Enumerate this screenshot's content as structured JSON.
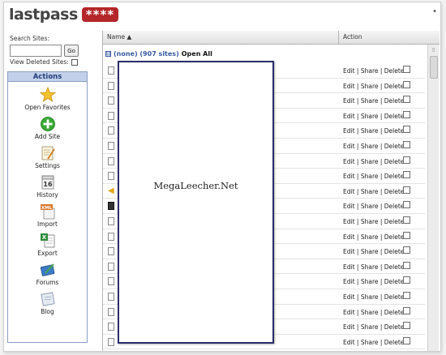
{
  "brand": {
    "logo_text": "lastpass",
    "logo_badge": "****",
    "corner_mark": "•"
  },
  "search": {
    "label": "Search Sites:",
    "value": "",
    "go_label": "Go",
    "deleted_label": "View Deleted Sites:"
  },
  "actions": {
    "title": "Actions",
    "items": [
      {
        "label": "Open Favorites",
        "icon": "star-icon"
      },
      {
        "label": "Add Site",
        "icon": "add-icon"
      },
      {
        "label": "Settings",
        "icon": "settings-icon"
      },
      {
        "label": "History",
        "icon": "calendar-icon",
        "badge": "16"
      },
      {
        "label": "Import",
        "icon": "xml-import-icon",
        "badge": "XML"
      },
      {
        "label": "Export",
        "icon": "excel-export-icon"
      },
      {
        "label": "Forums",
        "icon": "forums-icon"
      },
      {
        "label": "Blog",
        "icon": "blog-icon"
      }
    ]
  },
  "grid": {
    "col_name": "Name ▲",
    "col_action": "Action",
    "group": {
      "toggle": "⊟",
      "name": "(none) (907 sites)",
      "open_all": "Open All"
    },
    "row_action": {
      "edit": "Edit",
      "share": "Share",
      "delete": "Delete",
      "separator": " | "
    },
    "rows": [
      {
        "icon": "file-icon"
      },
      {
        "icon": "file-icon"
      },
      {
        "icon": "file-icon"
      },
      {
        "icon": "file-icon"
      },
      {
        "icon": "file-icon"
      },
      {
        "icon": "file-icon"
      },
      {
        "icon": "file-icon"
      },
      {
        "icon": "file-icon"
      },
      {
        "icon": "arrow-icon"
      },
      {
        "icon": "favicon-icon"
      },
      {
        "icon": "file-icon"
      },
      {
        "icon": "file-icon"
      },
      {
        "icon": "file-icon"
      },
      {
        "icon": "file-icon"
      },
      {
        "icon": "file-icon"
      },
      {
        "icon": "file-icon"
      },
      {
        "icon": "file-icon"
      },
      {
        "icon": "file-icon"
      },
      {
        "icon": "file-icon"
      }
    ]
  },
  "overlay": {
    "watermark": "MegaLeecher.Net"
  },
  "colors": {
    "brand_red": "#b3262a",
    "link_blue": "#3a5ba0",
    "actions_header": "#c3d0ea",
    "overlay_border": "#2c2c6a"
  }
}
